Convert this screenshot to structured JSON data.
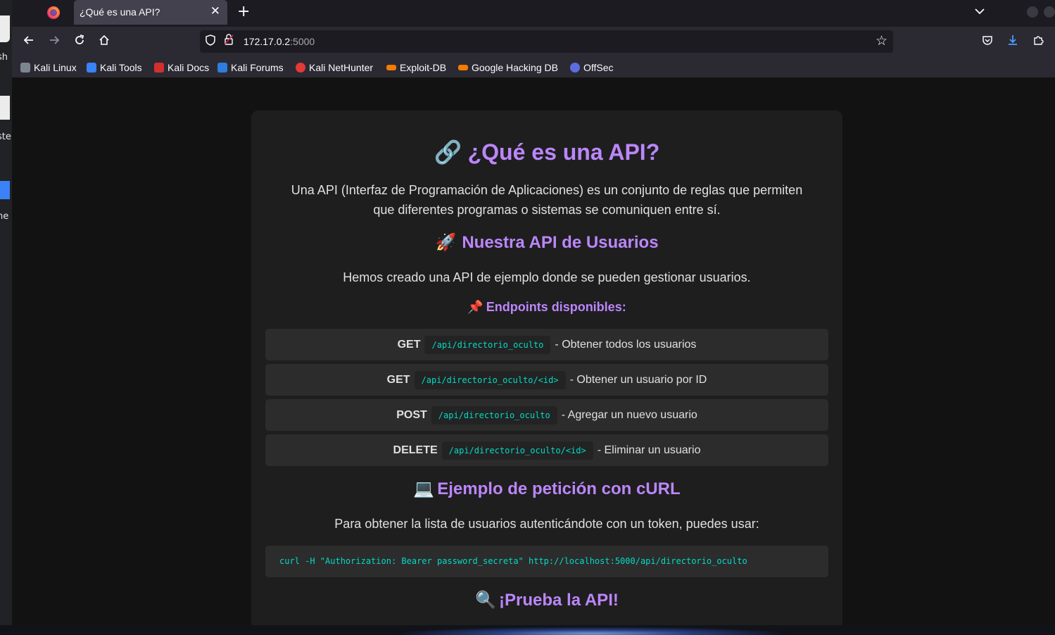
{
  "desktop": {
    "fragments": [
      "sh",
      "ste",
      "ne"
    ]
  },
  "browser": {
    "tab_title": "¿Qué es una API?",
    "tab_close_glyph": "✕",
    "new_tab_glyph": "+",
    "url_host": "172.17.0.2",
    "url_port": ":5000",
    "bookmarks": [
      {
        "label": "Kali Linux",
        "icon": "kali-linux-icon",
        "color": "#9aa0a6"
      },
      {
        "label": "Kali Tools",
        "icon": "kali-tools-icon",
        "color": "#3b82f6"
      },
      {
        "label": "Kali Docs",
        "icon": "kali-docs-icon",
        "color": "#d32f2f"
      },
      {
        "label": "Kali Forums",
        "icon": "kali-forums-icon",
        "color": "#2f7de1"
      },
      {
        "label": "Kali NetHunter",
        "icon": "kali-nethunter-icon",
        "color": "#e53935"
      },
      {
        "label": "Exploit-DB",
        "icon": "exploit-db-icon",
        "color": "#f57c00"
      },
      {
        "label": "Google Hacking DB",
        "icon": "google-hacking-db-icon",
        "color": "#f57c00"
      },
      {
        "label": "OffSec",
        "icon": "offsec-icon",
        "color": "#5b6ee1"
      }
    ]
  },
  "page": {
    "title_emoji": "🔗",
    "title": "¿Qué es una API?",
    "intro": "Una API (Interfaz de Programación de Aplicaciones) es un conjunto de reglas que permiten que diferentes programas o sistemas se comuniquen entre sí.",
    "section_api_emoji": "🚀",
    "section_api": "Nuestra API de Usuarios",
    "section_api_text": "Hemos creado una API de ejemplo donde se pueden gestionar usuarios.",
    "endpoints_emoji": "📌",
    "endpoints_heading": "Endpoints disponibles:",
    "endpoints": [
      {
        "method": "GET",
        "path": "/api/directorio_oculto",
        "desc": "- Obtener todos los usuarios"
      },
      {
        "method": "GET",
        "path": "/api/directorio_oculto/<id>",
        "desc": "- Obtener un usuario por ID"
      },
      {
        "method": "POST",
        "path": "/api/directorio_oculto",
        "desc": "- Agregar un nuevo usuario"
      },
      {
        "method": "DELETE",
        "path": "/api/directorio_oculto/<id>",
        "desc": "- Eliminar un usuario"
      }
    ],
    "curl_emoji": "💻",
    "curl_heading": "Ejemplo de petición con cURL",
    "curl_text": "Para obtener la lista de usuarios autenticándote con un token, puedes usar:",
    "curl_command": "curl -H \"Authorization: Bearer password_secreta\" http://localhost:5000/api/directorio_oculto",
    "try_emoji": "🔍",
    "try_heading": "¡Prueba la API!"
  },
  "colors": {
    "accent": "#bb86fc",
    "code": "#03dac6",
    "card": "#1e1e1e",
    "background": "#121212"
  }
}
